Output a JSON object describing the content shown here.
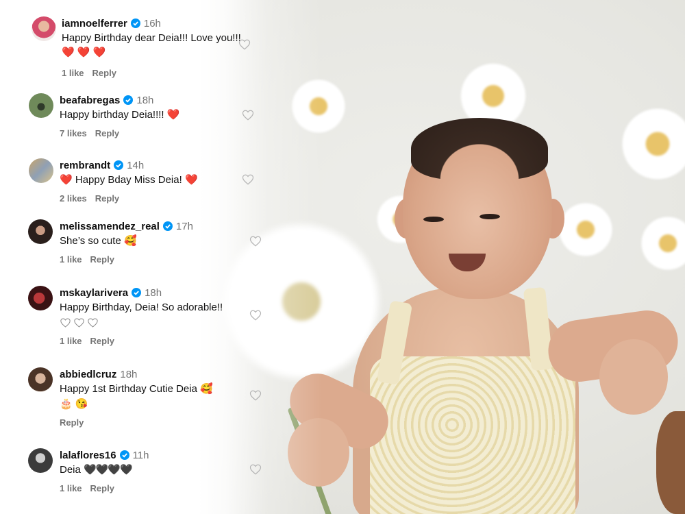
{
  "comments": [
    {
      "username": "iamnoelferrer",
      "verified": true,
      "time": "16h",
      "text": "Happy Birthday dear Deia!!! Love you!!!",
      "text_suffix": "❤️ ❤️ ❤️",
      "likes": "1 like",
      "reply": "Reply"
    },
    {
      "username": "beafabregas",
      "verified": true,
      "time": "18h",
      "text": "Happy birthday Deia!!!!",
      "text_suffix": "❤️",
      "likes": "7 likes",
      "reply": "Reply"
    },
    {
      "username": "rembrandt",
      "verified": true,
      "time": "14h",
      "text_prefix": "❤️",
      "text": "Happy Bday Miss Deia!",
      "text_suffix": "❤️",
      "likes": "2 likes",
      "reply": "Reply"
    },
    {
      "username": "melissamendez_real",
      "verified": true,
      "time": "17h",
      "text": "She’s so cute",
      "text_suffix": "🥰",
      "likes": "1 like",
      "reply": "Reply"
    },
    {
      "username": "mskaylarivera",
      "verified": true,
      "time": "18h",
      "text": "Happy Birthday, Deia! So adorable!!",
      "likes": "1 like",
      "reply": "Reply"
    },
    {
      "username": "abbiedlcruz",
      "verified": false,
      "time": "18h",
      "text": "Happy 1st Birthday Cutie Deia",
      "text_suffix": "🥰",
      "line2": "🎂 😘",
      "reply": "Reply"
    },
    {
      "username": "lalaflores16",
      "verified": true,
      "time": "11h",
      "text": "Deia",
      "text_suffix": "🖤🖤🖤🖤",
      "likes": "1 like",
      "reply": "Reply"
    }
  ],
  "colors": {
    "verified": "#0095f6",
    "meta": "#737373",
    "heart": "#e0245e"
  }
}
